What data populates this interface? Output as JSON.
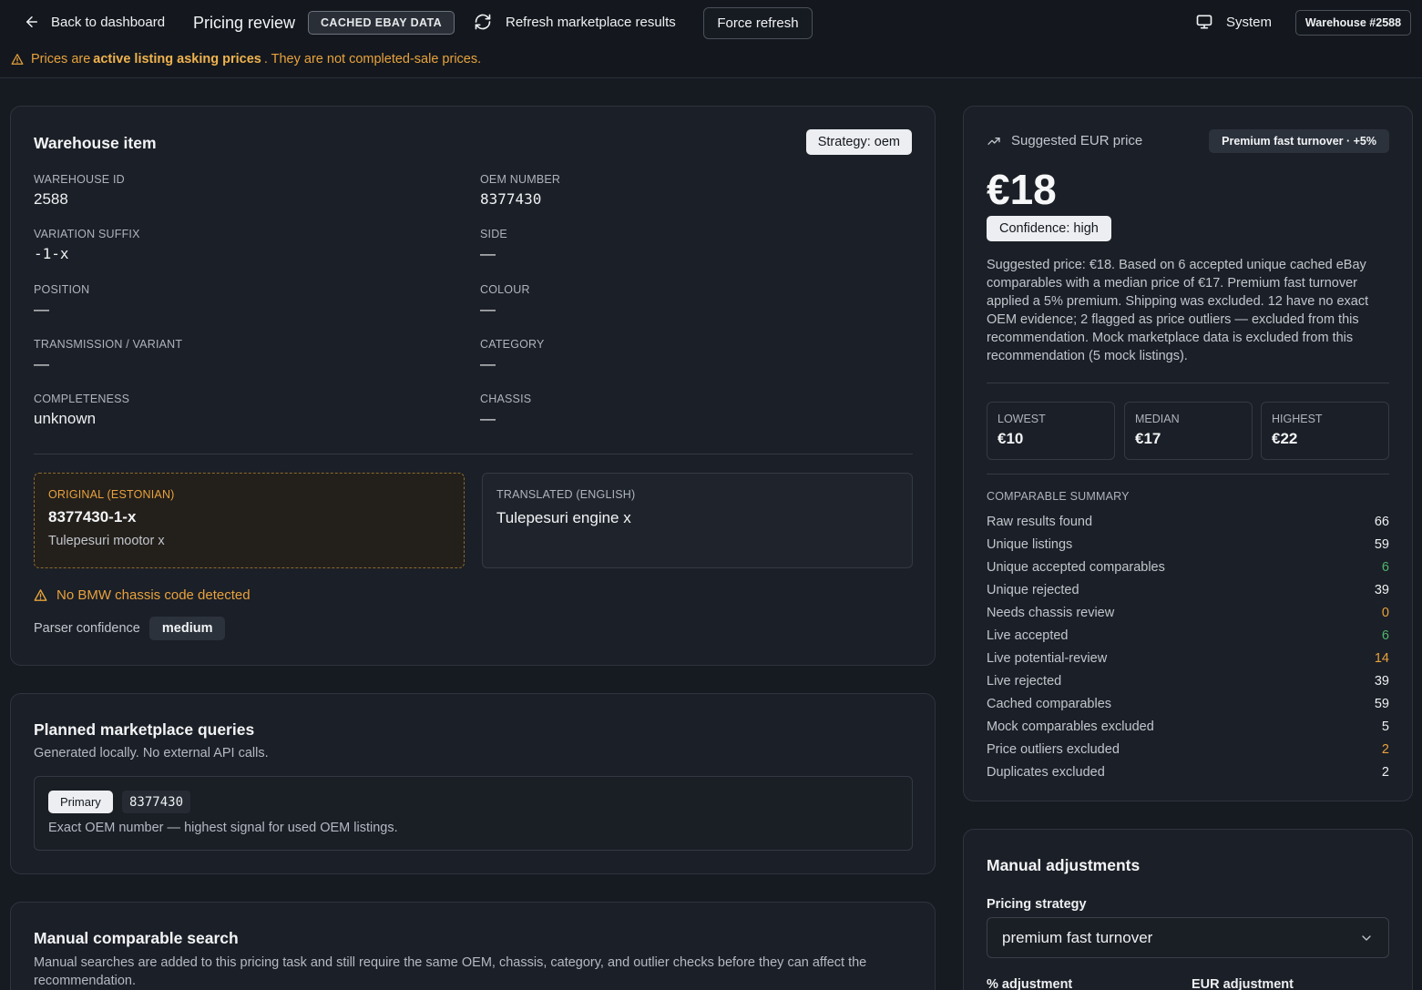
{
  "topbar": {
    "back_label": "Back to dashboard",
    "title": "Pricing review",
    "cache_badge": "CACHED EBAY DATA",
    "refresh_label": "Refresh marketplace results",
    "force_refresh_label": "Force refresh",
    "system_label": "System",
    "warehouse_badge": "Warehouse #2588",
    "warning_prefix": "Prices are",
    "warning_bold": "active listing asking prices",
    "warning_suffix": ". They are not completed-sale prices."
  },
  "item": {
    "title": "Warehouse item",
    "strategy": "Strategy: oem",
    "fields": {
      "warehouse_id_label": "Warehouse ID",
      "warehouse_id": "2588",
      "oem_label": "OEM number",
      "oem": "8377430",
      "variation_label": "Variation suffix",
      "variation": "-1-x",
      "side_label": "Side",
      "side": "—",
      "position_label": "Position",
      "position": "—",
      "colour_label": "Colour",
      "colour": "—",
      "transmission_label": "Transmission / variant",
      "transmission": "—",
      "category_label": "Category",
      "category": "—",
      "completeness_label": "Completeness",
      "completeness": "unknown",
      "chassis_label": "Chassis",
      "chassis": "—"
    },
    "original": {
      "label": "Original (Estonian)",
      "code": "8377430-1-x",
      "text": "Tulepesuri mootor x"
    },
    "translated": {
      "label": "Translated (English)",
      "text": "Tulepesuri engine x"
    },
    "chassis_warning": "No BMW chassis code detected",
    "parser_label": "Parser confidence",
    "parser_value": "medium"
  },
  "queries": {
    "title": "Planned marketplace queries",
    "subtitle": "Generated locally. No external API calls.",
    "items": [
      {
        "tag": "Primary",
        "query": "8377430",
        "description": "Exact OEM number — highest signal for used OEM listings."
      }
    ]
  },
  "manual_search": {
    "title": "Manual comparable search",
    "subtitle": "Manual searches are added to this pricing task and still require the same OEM, chassis, category, and outlier checks before they can affect the recommendation."
  },
  "suggestion": {
    "heading": "Suggested EUR price",
    "premium_badge": "Premium fast turnover · +5%",
    "price": "€18",
    "confidence": "Confidence: high",
    "explanation": "Suggested price: €18. Based on 6 accepted unique cached eBay comparables with a median price of €17. Premium fast turnover applied a 5% premium. Shipping was excluded. 12 have no exact OEM evidence; 2 flagged as price outliers — excluded from this recommendation. Mock marketplace data is excluded from this recommendation (5 mock listings).",
    "stats": [
      {
        "label": "Lowest",
        "value": "€10"
      },
      {
        "label": "Median",
        "value": "€17"
      },
      {
        "label": "Highest",
        "value": "€22"
      }
    ],
    "summary_title": "Comparable summary",
    "summary": [
      {
        "label": "Raw results found",
        "value": "66",
        "tone": ""
      },
      {
        "label": "Unique listings",
        "value": "59",
        "tone": ""
      },
      {
        "label": "Unique accepted comparables",
        "value": "6",
        "tone": "green"
      },
      {
        "label": "Unique rejected",
        "value": "39",
        "tone": ""
      },
      {
        "label": "Needs chassis review",
        "value": "0",
        "tone": "orange"
      },
      {
        "label": "Live accepted",
        "value": "6",
        "tone": "green"
      },
      {
        "label": "Live potential-review",
        "value": "14",
        "tone": "orange"
      },
      {
        "label": "Live rejected",
        "value": "39",
        "tone": ""
      },
      {
        "label": "Cached comparables",
        "value": "59",
        "tone": ""
      },
      {
        "label": "Mock comparables excluded",
        "value": "5",
        "tone": ""
      },
      {
        "label": "Price outliers excluded",
        "value": "2",
        "tone": "orange"
      },
      {
        "label": "Duplicates excluded",
        "value": "2",
        "tone": ""
      }
    ]
  },
  "adjustments": {
    "title": "Manual adjustments",
    "strategy_label": "Pricing strategy",
    "strategy_value": "premium fast turnover",
    "pct_label": "% adjustment",
    "eur_label": "EUR adjustment"
  }
}
